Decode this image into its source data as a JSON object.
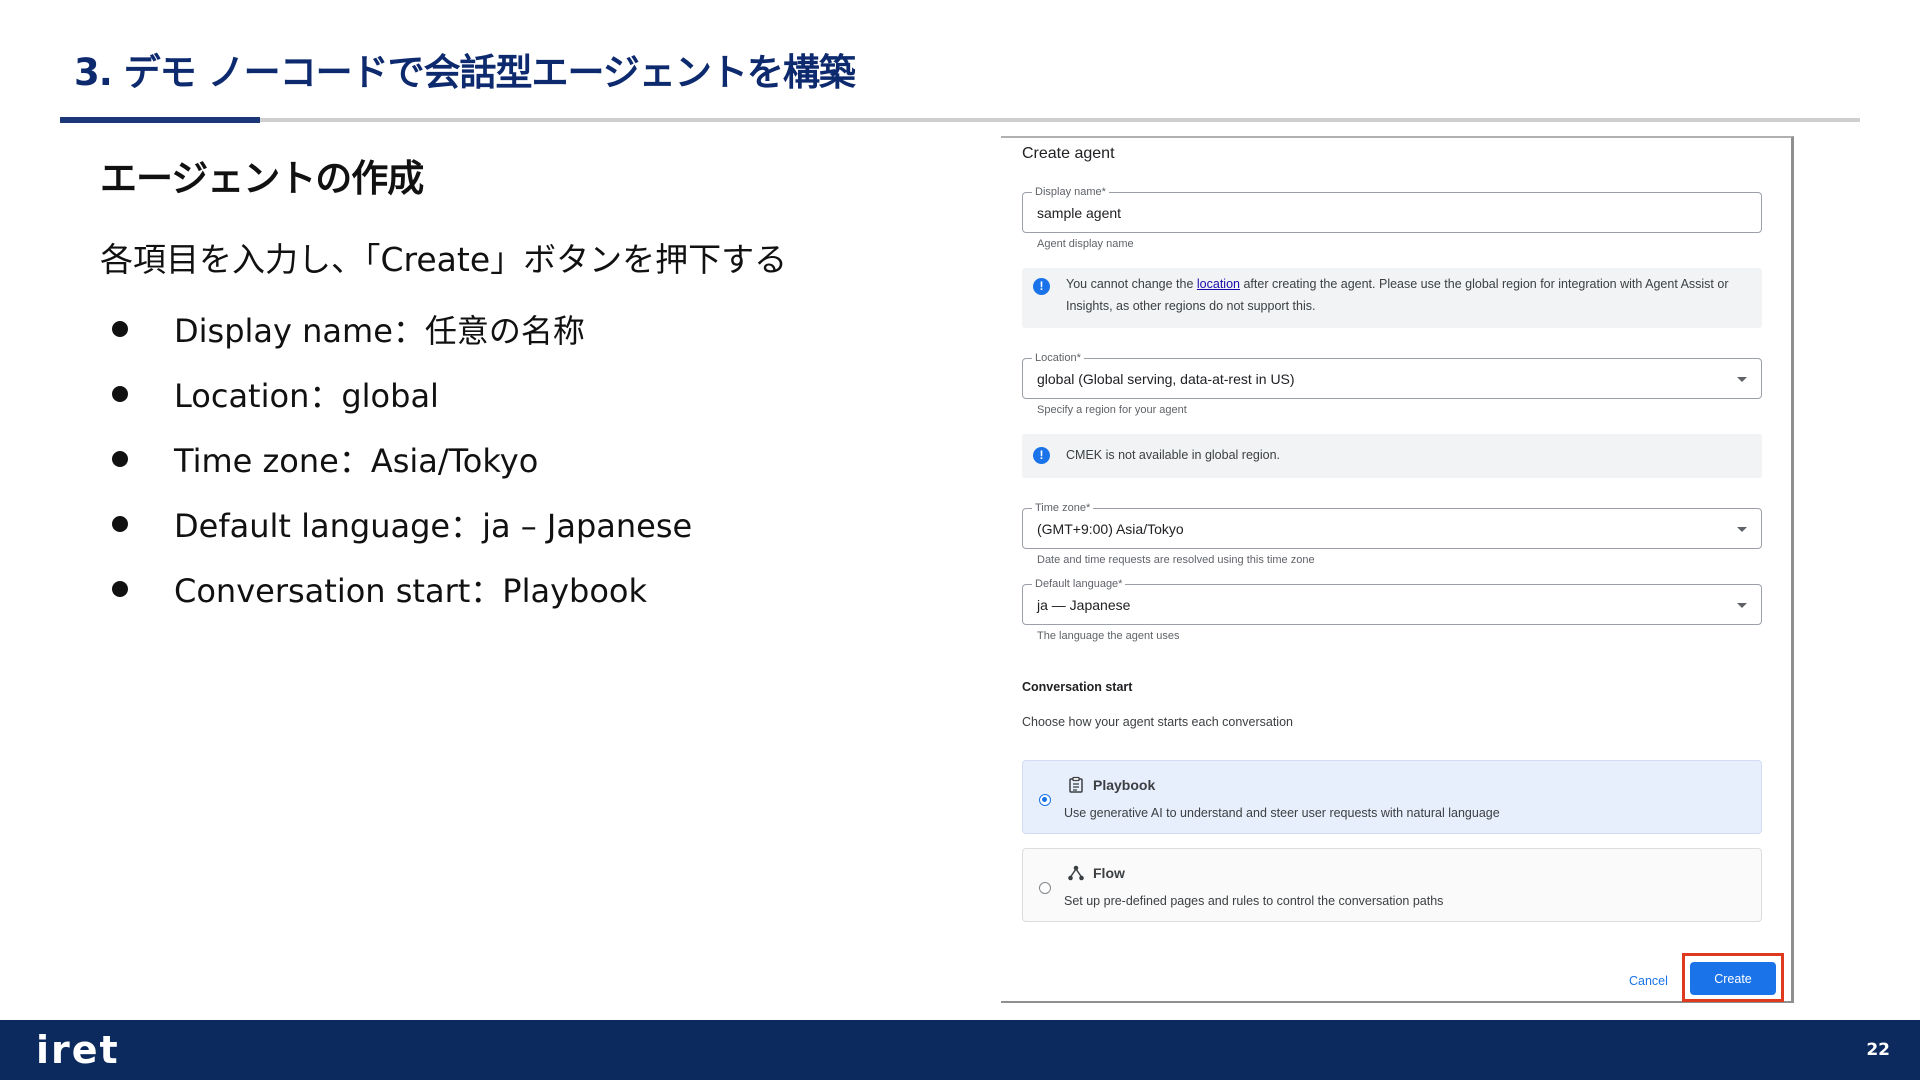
{
  "slide": {
    "title": "3. デモ ノーコードで会話型エージェントを構築",
    "heading": "エージェントの作成",
    "instruction": "各項目を入力し、「Create」ボタンを押下する",
    "bullets": [
      "Display name：任意の名称",
      "Location：global",
      "Time zone：Asia/Tokyo",
      "Default language：ja – Japanese",
      "Conversation start：Playbook"
    ],
    "page_number": "22",
    "logo_text": "iret"
  },
  "dialog": {
    "title": "Create agent",
    "display_name": {
      "label": "Display name*",
      "value": "sample agent",
      "hint": "Agent display name"
    },
    "location_notice": {
      "text_before": "You cannot change the ",
      "link_text": "location",
      "text_after": " after creating the agent. Please use the global region for integration with Agent Assist or Insights, as other regions do not support this."
    },
    "location": {
      "label": "Location*",
      "value": "global (Global serving, data-at-rest in US)",
      "hint": "Specify a region for your agent"
    },
    "cmek_notice": "CMEK is not available in global region.",
    "time_zone": {
      "label": "Time zone*",
      "value": "(GMT+9:00) Asia/Tokyo",
      "hint": "Date and time requests are resolved using this time zone"
    },
    "default_language": {
      "label": "Default language*",
      "value": "ja — Japanese",
      "hint": "The language the agent uses"
    },
    "conversation_start": {
      "heading": "Conversation start",
      "description": "Choose how your agent starts each conversation",
      "options": [
        {
          "title": "Playbook",
          "description": "Use generative AI to understand and steer user requests with natural language",
          "selected": true,
          "icon": "clipboard-icon"
        },
        {
          "title": "Flow",
          "description": "Set up pre-defined pages and rules to control the conversation paths",
          "selected": false,
          "icon": "flow-icon"
        }
      ]
    },
    "cancel_label": "Cancel",
    "create_label": "Create"
  },
  "colors": {
    "title_navy": "#0d2a6e",
    "footer_navy": "#0d2a5e",
    "accent_blue": "#1a73e8",
    "highlight_red": "#e03a1e"
  }
}
